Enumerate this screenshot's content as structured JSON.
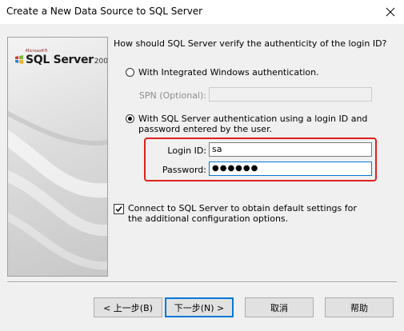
{
  "window": {
    "title": "Create a New Data Source to SQL Server",
    "close_icon": "close-icon"
  },
  "logo": {
    "microsoft": "Microsoft®",
    "product": "SQL Server",
    "year": "2008"
  },
  "question": "How should SQL Server verify the authenticity of the login ID?",
  "auth_options": {
    "integrated": {
      "label": "With Integrated Windows authentication.",
      "selected": false
    },
    "sql": {
      "label": "With SQL Server authentication using a login ID and password entered by the user.",
      "selected": true
    }
  },
  "spn": {
    "label": "SPN (Optional):",
    "value": ""
  },
  "login": {
    "label": "Login ID:",
    "value": "sa"
  },
  "password": {
    "label": "Password:",
    "value": "●●●●●●"
  },
  "connect_option": {
    "label": "Connect to SQL Server to obtain default settings for the additional configuration options.",
    "checked": true
  },
  "buttons": {
    "back": "< 上一步(B)",
    "next": "下一步(N) >",
    "cancel": "取消",
    "help": "帮助"
  },
  "colors": {
    "accent": "#0078d7",
    "highlight": "#e0201b"
  }
}
